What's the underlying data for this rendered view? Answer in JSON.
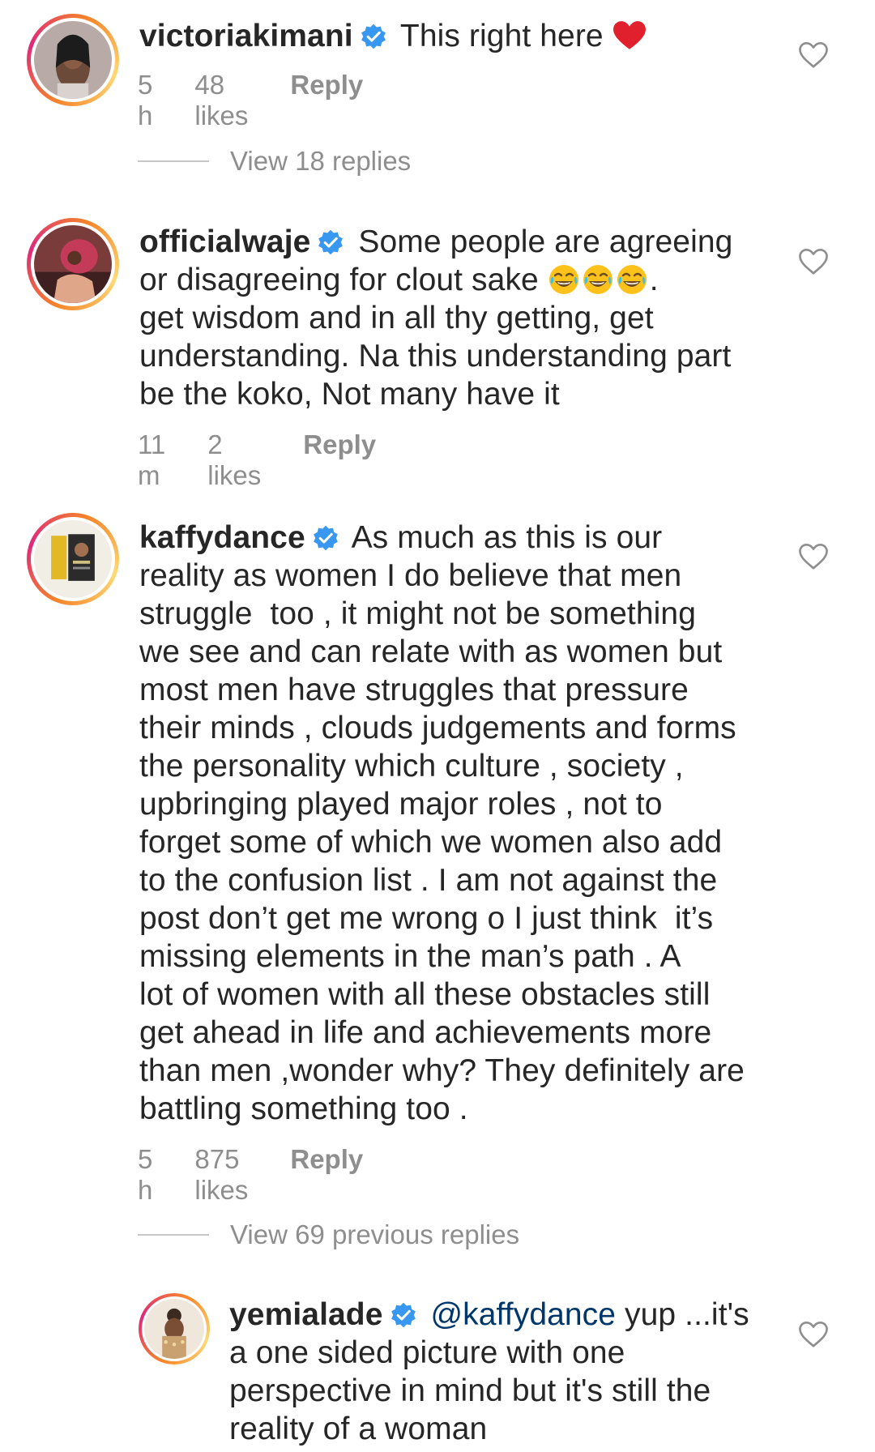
{
  "comments": [
    {
      "username": "victoriakimani",
      "text_lines": [
        "This right here"
      ],
      "trailing_emoji": "red-heart",
      "time": "5 h",
      "likes": "48 likes",
      "reply": "Reply"
    },
    {
      "username": "officialwaje",
      "text_lines": [
        "Some people are agreeing",
        "or disagreeing for clout sake",
        "get wisdom and in all thy getting, get",
        "understanding. Na this understanding part",
        "be the koko, Not many have it"
      ],
      "emoji_after_line2": "face-with-tears-of-joy x3",
      "line2_suffix": ".",
      "time": "11 m",
      "likes": "2 likes",
      "reply": "Reply"
    },
    {
      "username": "kaffydance",
      "text_lines": [
        "As much as this is our",
        "reality as women I do believe that men",
        "struggle  too , it might not be something",
        "we see and can relate with as women but",
        "most men have struggles that pressure",
        "their minds , clouds judgements and forms",
        "the personality which culture , society ,",
        "upbringing played major roles , not to",
        "forget some of which we women also add",
        "to the confusion list . I am not against the",
        "post don’t get me wrong o I just think  it’s",
        "missing elements in the man’s path . A",
        "lot of women with all these obstacles still",
        "get ahead in life and achievements more",
        "than men ,wonder why? They definitely are",
        "battling something too ."
      ],
      "time": "5 h",
      "likes": "875 likes",
      "reply": "Reply"
    },
    {
      "username": "yemialade",
      "mention": "@kaffydance",
      "text_lines": [
        " yup ...it's",
        "a one sided picture with one",
        "perspective in mind but it's still the",
        "reality of a woman"
      ]
    }
  ],
  "view_replies": {
    "first": "View 18 replies",
    "second": "View 69 previous replies"
  },
  "icons": {
    "verified": "verified-badge-icon",
    "like": "heart-outline-icon"
  },
  "colors": {
    "text": "#262626",
    "meta": "#8e8e8e",
    "verified": "#3897f0",
    "mention": "#00376b"
  }
}
